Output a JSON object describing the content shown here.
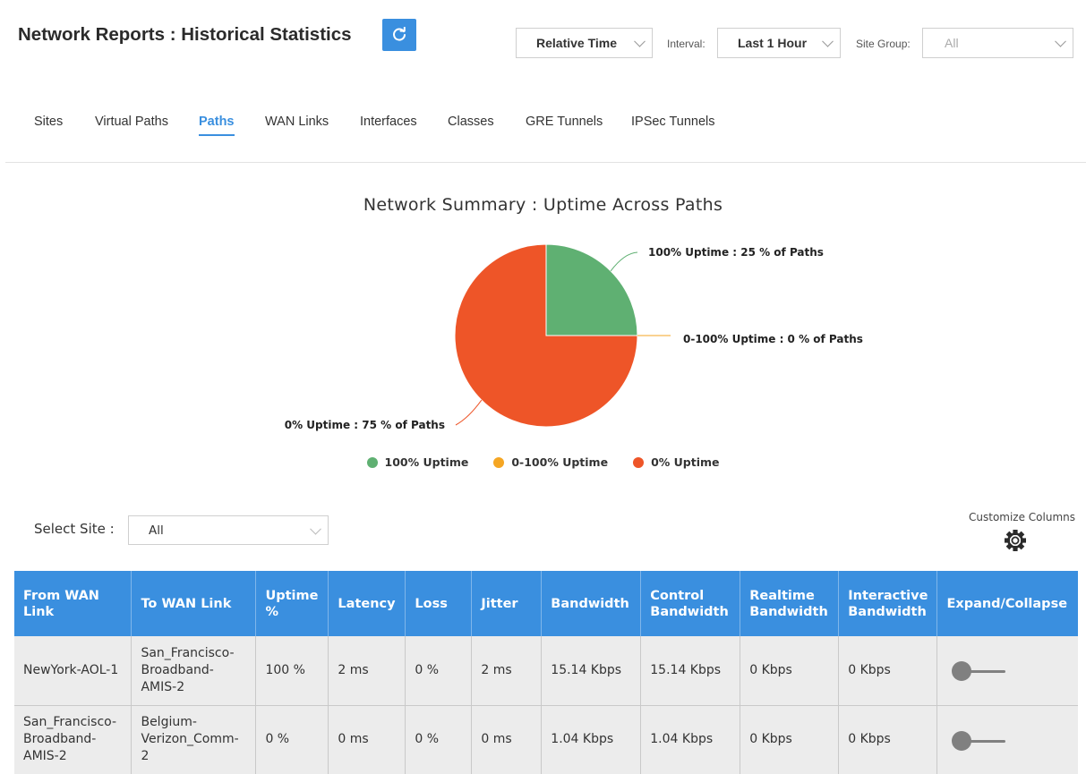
{
  "header": {
    "title": "Network Reports : Historical Statistics",
    "refresh_icon": "refresh-icon",
    "time_mode": "Relative Time",
    "interval_label": "Interval:",
    "interval_value": "Last 1 Hour",
    "site_group_label": "Site Group:",
    "site_group_value": "All"
  },
  "tabs": [
    {
      "label": "Sites",
      "active": false
    },
    {
      "label": "Virtual Paths",
      "active": false
    },
    {
      "label": "Paths",
      "active": true
    },
    {
      "label": "WAN Links",
      "active": false
    },
    {
      "label": "Interfaces",
      "active": false
    },
    {
      "label": "Classes",
      "active": false
    },
    {
      "label": "GRE Tunnels",
      "active": false
    },
    {
      "label": "IPSec Tunnels",
      "active": false
    }
  ],
  "colors": {
    "accent": "#3a8fdf",
    "uptime_100": "#5fb072",
    "uptime_partial": "#f5a623",
    "uptime_0": "#ee5528"
  },
  "chart_data": {
    "type": "pie",
    "title": "Network Summary : Uptime Across Paths",
    "categories": [
      "100% Uptime",
      "0-100% Uptime",
      "0% Uptime"
    ],
    "values": [
      25,
      0,
      75
    ],
    "unit": "% of Paths",
    "slice_labels": [
      "100% Uptime : 25 % of Paths",
      "0-100% Uptime : 0 % of Paths",
      "0% Uptime : 75 % of Paths"
    ],
    "legend": [
      "100% Uptime",
      "0-100% Uptime",
      "0% Uptime"
    ],
    "legend_position": "bottom"
  },
  "filter": {
    "select_site_label": "Select Site :",
    "select_site_value": "All"
  },
  "customize": {
    "label": "Customize Columns",
    "icon": "gear-icon"
  },
  "table": {
    "columns": [
      "From WAN Link",
      "To WAN Link",
      "Uptime %",
      "Latency",
      "Loss",
      "Jitter",
      "Bandwidth",
      "Control Bandwidth",
      "Realtime Bandwidth",
      "Interactive Bandwidth",
      "Expand/Collapse"
    ],
    "rows": [
      {
        "from": "NewYork-AOL-1",
        "to": "San_Francisco-Broadband-AMIS-2",
        "uptime": "100 %",
        "latency": "2 ms",
        "loss": "0 %",
        "jitter": "2 ms",
        "bandwidth": "15.14 Kbps",
        "control_bw": "15.14 Kbps",
        "realtime_bw": "0 Kbps",
        "interactive_bw": "0 Kbps"
      },
      {
        "from": "San_Francisco-Broadband-AMIS-2",
        "to": "Belgium-Verizon_Comm-2",
        "uptime": "0 %",
        "latency": "0 ms",
        "loss": "0 %",
        "jitter": "0 ms",
        "bandwidth": "1.04 Kbps",
        "control_bw": "1.04 Kbps",
        "realtime_bw": "0 Kbps",
        "interactive_bw": "0 Kbps"
      }
    ]
  }
}
